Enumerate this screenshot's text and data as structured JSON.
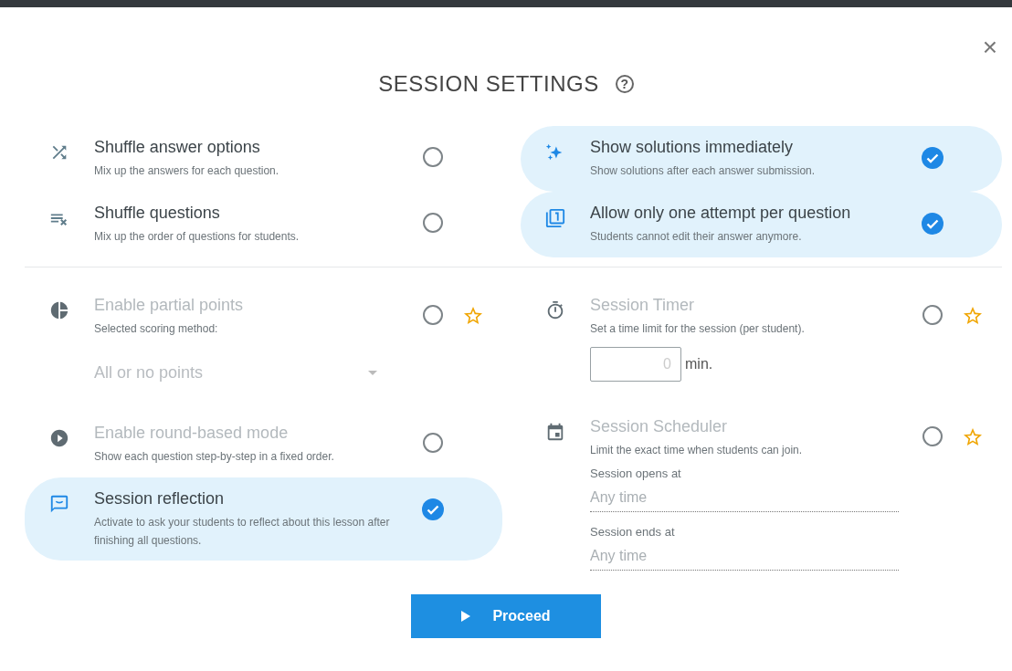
{
  "title": "SESSION SETTINGS",
  "help_icon": "?",
  "close": "×",
  "top_left": [
    {
      "title": "Shuffle answer options",
      "description": "Mix up the answers for each question.",
      "checked": false,
      "disabled": false,
      "premium": false
    },
    {
      "title": "Shuffle questions",
      "description": "Mix up the order of questions for students.",
      "checked": false,
      "disabled": false,
      "premium": false
    }
  ],
  "top_right": [
    {
      "title": "Show solutions immediately",
      "description": "Show solutions after each answer submission.",
      "checked": true,
      "disabled": false,
      "premium": false
    },
    {
      "title": "Allow only one attempt per question",
      "description": "Students cannot edit their answer anymore.",
      "checked": true,
      "disabled": false,
      "premium": false
    }
  ],
  "bottom_left": [
    {
      "kind": "select",
      "title": "Enable partial points",
      "description": "Selected scoring method:",
      "checked": false,
      "disabled": true,
      "premium": true,
      "select_value": "All or no points"
    },
    {
      "title": "Enable round-based mode",
      "description": "Show each question step-by-step in a fixed order.",
      "checked": false,
      "disabled": true,
      "premium": false
    },
    {
      "title": "Session reflection",
      "description": "Activate to ask your students to reflect about this lesson after finishing all questions.",
      "checked": true,
      "disabled": false,
      "premium": false
    }
  ],
  "bottom_right": [
    {
      "kind": "timer",
      "title": "Session Timer",
      "description": "Set a time limit for the session (per student).",
      "checked": false,
      "disabled": true,
      "premium": true,
      "input_value": "0",
      "unit": "min."
    },
    {
      "kind": "schedule",
      "title": "Session Scheduler",
      "description": "Limit the exact time when students can join.",
      "checked": false,
      "disabled": true,
      "premium": true,
      "fields": [
        {
          "label": "Session opens at",
          "placeholder": "Any time"
        },
        {
          "label": "Session ends at",
          "placeholder": "Any time"
        }
      ]
    }
  ],
  "proceed_button": "Proceed"
}
